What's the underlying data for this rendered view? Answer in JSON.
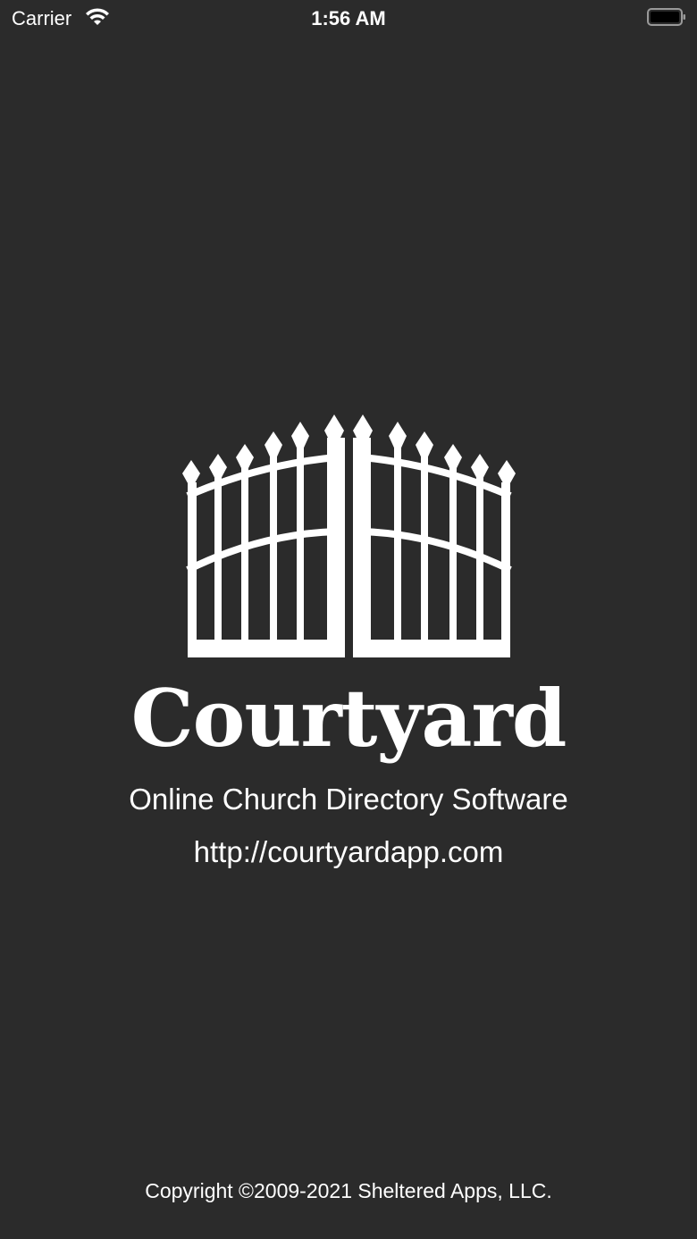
{
  "status_bar": {
    "carrier": "Carrier",
    "time": "1:56 AM",
    "wifi_icon": "wifi-icon",
    "battery_icon": "battery-icon"
  },
  "logo": {
    "icon": "gate-icon",
    "title": "Courtyard"
  },
  "tagline": "Online Church Directory Software",
  "url": "http://courtyardapp.com",
  "copyright": "Copyright ©2009-2021 Sheltered Apps, LLC.",
  "colors": {
    "background": "#2b2b2b",
    "foreground": "#ffffff"
  }
}
